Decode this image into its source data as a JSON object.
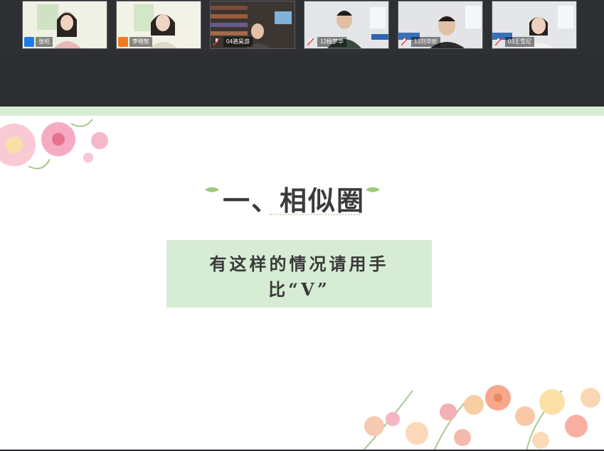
{
  "participants": [
    {
      "name": "张昭",
      "role": "host",
      "bg": "#e9eedb"
    },
    {
      "name": "李晓智",
      "role": "cohost",
      "bg": "#eef0dc"
    },
    {
      "name": "04骆昊游",
      "role": "attendee",
      "bg": "#3e3a36"
    },
    {
      "name": "12杨梦华",
      "role": "attendee",
      "bg": "#d9dce0"
    },
    {
      "name": "13刘华昕",
      "role": "attendee",
      "bg": "#d7dadf"
    },
    {
      "name": "03王雪尼",
      "role": "attendee",
      "bg": "#dadde2"
    }
  ],
  "slide": {
    "title": "一、相似圈",
    "prompt_line1": "有这样的情况请用手",
    "prompt_line2": "比“V”"
  },
  "colors": {
    "host_badge": "#1e7ce8",
    "cohost_badge": "#f07b20",
    "slide_green": "#d7ecd4",
    "title_text": "#3b3b3b"
  }
}
